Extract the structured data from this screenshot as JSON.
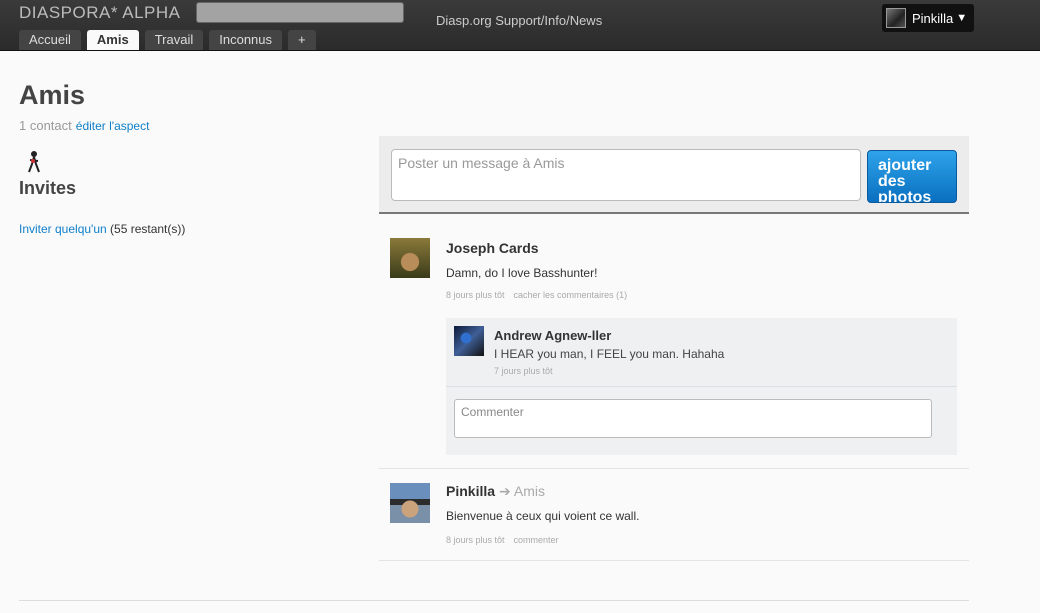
{
  "header": {
    "brand": "DIASPORA* ALPHA",
    "support_link": "Diasp.org Support/Info/News",
    "user_name": "Pinkilla",
    "user_caret": "▼",
    "tabs": [
      "Accueil",
      "Amis",
      "Travail",
      "Inconnus",
      "+"
    ],
    "active_tab": "Amis"
  },
  "aspect": {
    "title": "Amis",
    "contact_count": "1 contact",
    "edit_link": "éditer l'aspect"
  },
  "invites": {
    "title": "Invites",
    "invite_link": "Inviter quelqu'un",
    "remaining": " (55 restant(s))"
  },
  "publisher": {
    "placeholder": "Poster un message à Amis",
    "share_button": "ajouter des photos"
  },
  "posts": [
    {
      "author": "Joseph Cards",
      "text": "Damn, do I love Basshunter!",
      "time": "8 jours plus tôt",
      "action": "cacher les commentaires (1)",
      "comments": [
        {
          "author": "Andrew Agnew-ller",
          "text": "I HEAR you man, I FEEL you man. Hahaha",
          "time": "7 jours plus tôt"
        }
      ],
      "comment_placeholder": "Commenter"
    },
    {
      "author": "Pinkilla",
      "aspect": "➔ Amis",
      "text": "Bienvenue à ceux qui voient ce wall.",
      "time": "8 jours plus tôt",
      "action": "commenter"
    }
  ]
}
